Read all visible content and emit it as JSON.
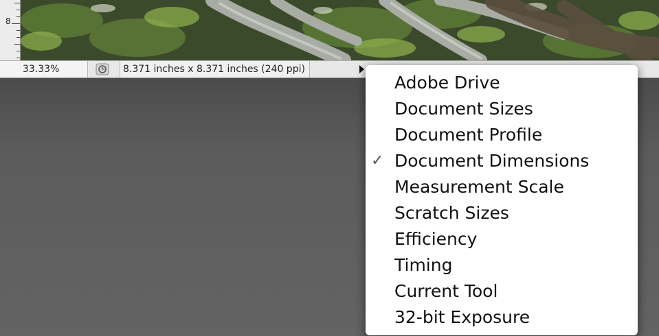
{
  "ruler": {
    "label": "8"
  },
  "status_bar": {
    "zoom": "33.33%",
    "info_icon": "document-info-icon",
    "doc_info": "8.371 inches x 8.371 inches (240 ppi)",
    "menu_arrow_icon": "triangle-right-icon"
  },
  "popup_menu": {
    "checked_index": 3,
    "check_glyph": "✓",
    "items": [
      {
        "label": "Adobe Drive"
      },
      {
        "label": "Document Sizes"
      },
      {
        "label": "Document Profile"
      },
      {
        "label": "Document Dimensions"
      },
      {
        "label": "Measurement Scale"
      },
      {
        "label": "Scratch Sizes"
      },
      {
        "label": "Efficiency"
      },
      {
        "label": "Timing"
      },
      {
        "label": "Current Tool"
      },
      {
        "label": "32-bit Exposure"
      }
    ]
  },
  "colors": {
    "workspace": "#5a5a5a",
    "status_bar": "#e8e8e8",
    "menu_background": "#ffffff"
  }
}
